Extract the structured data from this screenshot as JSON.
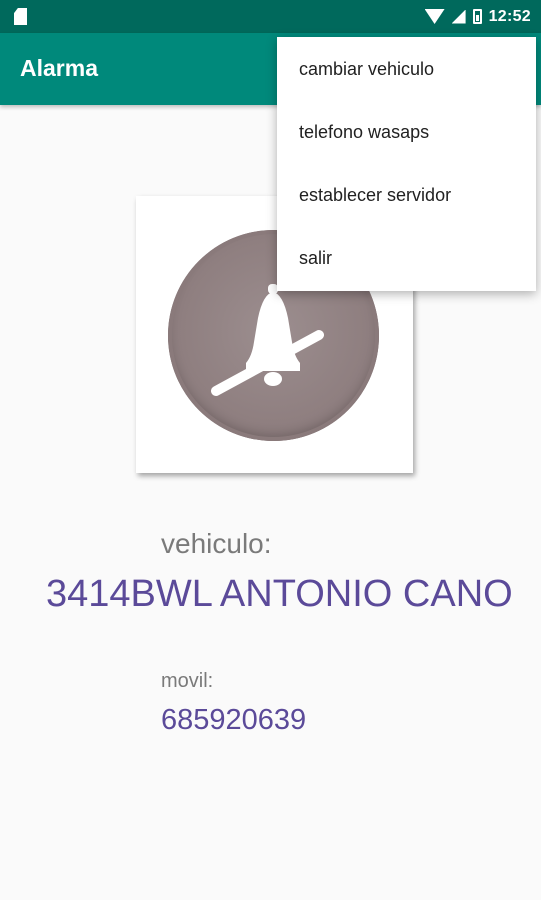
{
  "status_bar": {
    "time": "12:52",
    "icons": [
      "sd-card-icon",
      "wifi-icon",
      "cell-signal-icon",
      "battery-icon"
    ]
  },
  "app_bar": {
    "title": "Alarma"
  },
  "overflow_menu": {
    "items": [
      {
        "label": "cambiar vehiculo"
      },
      {
        "label": "telefono wasaps"
      },
      {
        "label": "establecer servidor"
      },
      {
        "label": "salir"
      }
    ]
  },
  "main": {
    "alarm_button_icon": "bell-off-icon",
    "vehicle_label": "vehiculo:",
    "vehicle_value": "3414BWL ANTONIO CANO",
    "movil_label": "movil:",
    "movil_value": "685920639"
  },
  "colors": {
    "status_bar": "#00695c",
    "app_bar": "#00897b",
    "accent_text": "#5b4a99",
    "label_text": "#7a7a7a",
    "disc": "#8f7f80"
  }
}
